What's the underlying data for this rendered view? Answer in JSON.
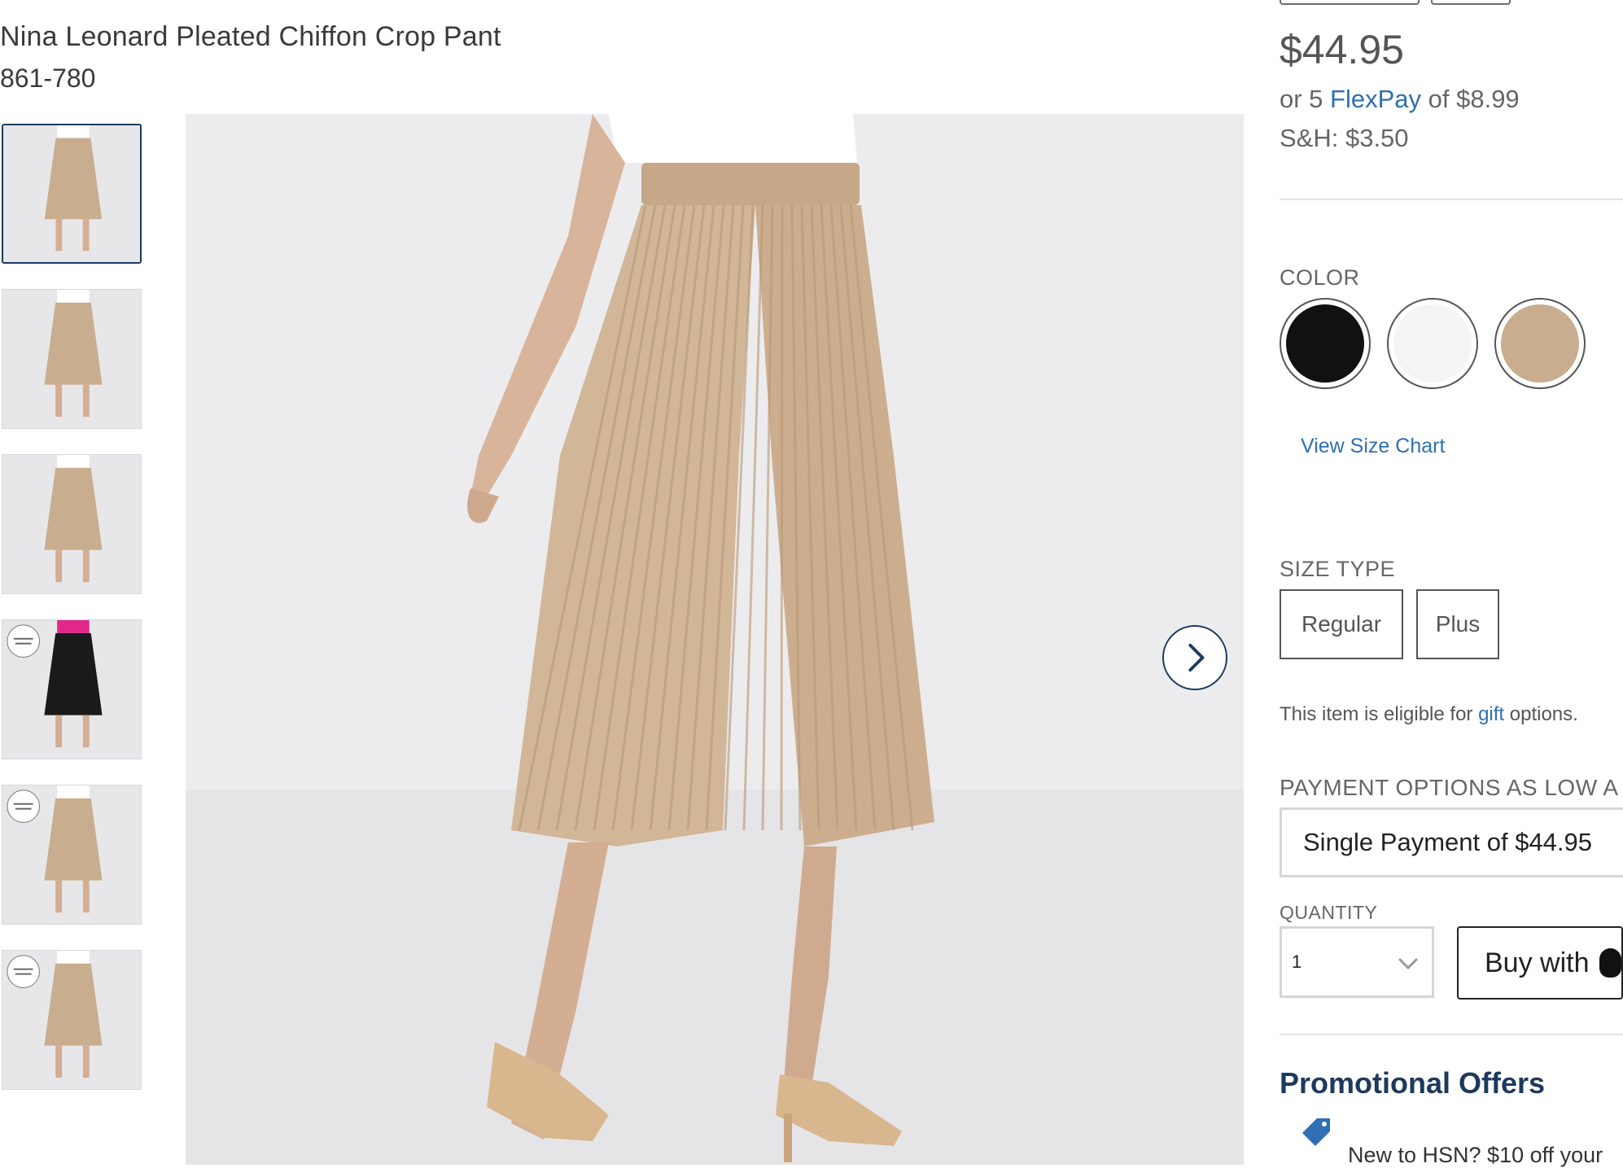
{
  "product": {
    "title": "Nina Leonard Pleated Chiffon Crop Pant",
    "sku": "861-780"
  },
  "thumbnails": [
    {
      "name": "thumb-1",
      "garment_color": "#c8ad8e",
      "selected": true,
      "badge": false
    },
    {
      "name": "thumb-2",
      "garment_color": "#c8ad8e",
      "selected": false,
      "badge": false
    },
    {
      "name": "thumb-3",
      "garment_color": "#c8ad8e",
      "selected": false,
      "badge": false
    },
    {
      "name": "thumb-4",
      "garment_color": "#1a1a1a",
      "selected": false,
      "badge": true
    },
    {
      "name": "thumb-5",
      "garment_color": "#c8ad8e",
      "selected": false,
      "badge": true
    },
    {
      "name": "thumb-6",
      "garment_color": "#c8ad8e",
      "selected": false,
      "badge": true
    }
  ],
  "pricing": {
    "price": "$44.95",
    "flexpay_prefix": "or 5 ",
    "flexpay_link": "FlexPay",
    "flexpay_suffix": " of $8.99",
    "shipping": "S&H: $3.50"
  },
  "color": {
    "label": "COLOR",
    "swatches": [
      {
        "name": "black",
        "hex": "#111111"
      },
      {
        "name": "white",
        "hex": "#f4f5f7"
      },
      {
        "name": "tan",
        "hex": "#c8ad8e"
      }
    ],
    "size_chart_link": "View Size Chart"
  },
  "size_type": {
    "label": "SIZE TYPE",
    "options": [
      "Regular",
      "Plus"
    ]
  },
  "gift": {
    "prefix": "This item is eligible for ",
    "link": "gift",
    "suffix": " options."
  },
  "payment": {
    "label": "PAYMENT OPTIONS AS LOW A",
    "selected": "Single Payment of $44.95"
  },
  "quantity": {
    "label": "QUANTITY",
    "value": "1"
  },
  "buy_button": {
    "label": "Buy with"
  },
  "promo": {
    "title": "Promotional Offers",
    "text": "New to HSN? $10 off your"
  },
  "icons": {
    "next_arrow": "chevron-right-icon",
    "qty_chevron": "chevron-down-icon",
    "promo": "tag-icon",
    "apple": "apple-icon"
  },
  "colors": {
    "accent_link": "#2f6fb3",
    "navy": "#1d3a5c",
    "garment_tan": "#c8ad8e"
  }
}
